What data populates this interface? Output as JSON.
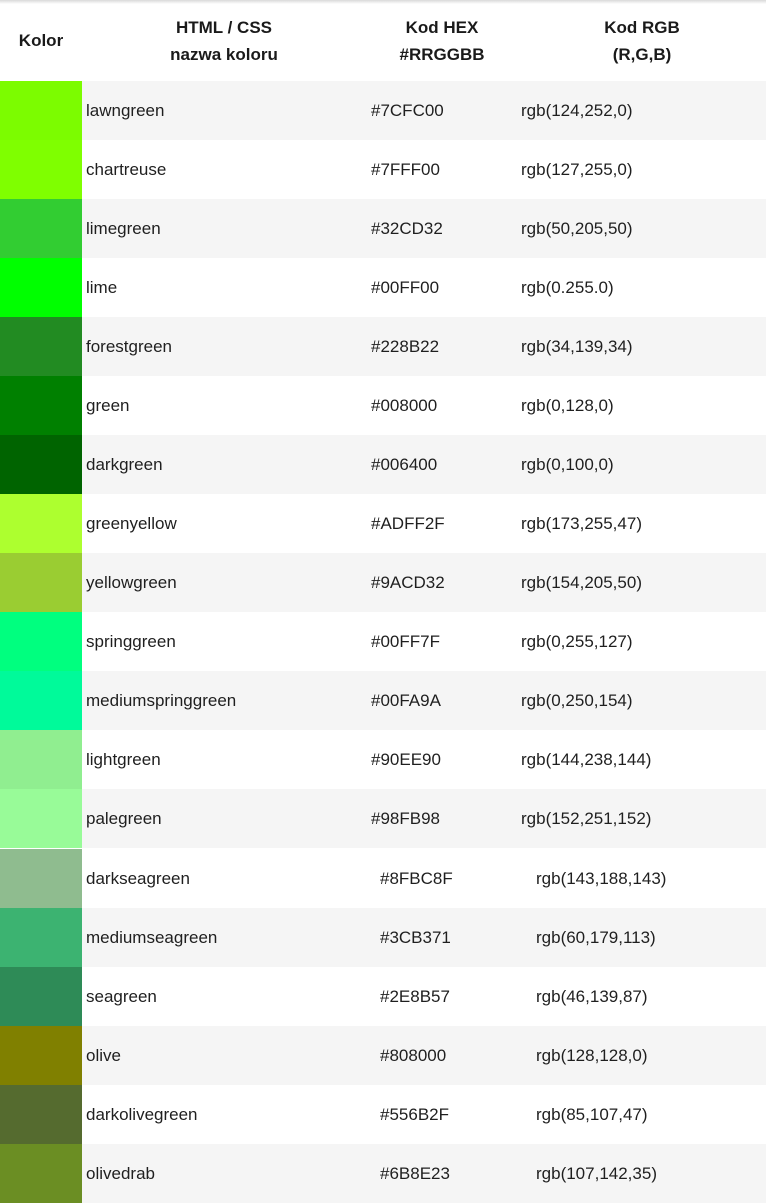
{
  "header": {
    "kolor": "Kolor",
    "name_line1": "HTML / CSS",
    "name_line2": "nazwa koloru",
    "hex_line1": "Kod HEX",
    "hex_line2": "#RRGGBB",
    "rgb_line1": "Kod RGB",
    "rgb_line2": "(R,G,B)"
  },
  "rows": [
    {
      "color": "#7CFC00",
      "name": "lawngreen",
      "hex": "#7CFC00",
      "rgb": "rgb(124,252,0)"
    },
    {
      "color": "#7FFF00",
      "name": "chartreuse",
      "hex": "#7FFF00",
      "rgb": "rgb(127,255,0)"
    },
    {
      "color": "#32CD32",
      "name": "limegreen",
      "hex": "#32CD32",
      "rgb": "rgb(50,205,50)"
    },
    {
      "color": "#00FF00",
      "name": "lime",
      "hex": "#00FF00",
      "rgb": "rgb(0.255.0)"
    },
    {
      "color": "#228B22",
      "name": "forestgreen",
      "hex": "#228B22",
      "rgb": "rgb(34,139,34)"
    },
    {
      "color": "#008000",
      "name": "green",
      "hex": "#008000",
      "rgb": "rgb(0,128,0)"
    },
    {
      "color": "#006400",
      "name": "darkgreen",
      "hex": "#006400",
      "rgb": "rgb(0,100,0)"
    },
    {
      "color": "#ADFF2F",
      "name": "greenyellow",
      "hex": "#ADFF2F",
      "rgb": "rgb(173,255,47)"
    },
    {
      "color": "#9ACD32",
      "name": "yellowgreen",
      "hex": "#9ACD32",
      "rgb": "rgb(154,205,50)"
    },
    {
      "color": "#00FF7F",
      "name": "springgreen",
      "hex": "#00FF7F",
      "rgb": "rgb(0,255,127)"
    },
    {
      "color": "#00FA9A",
      "name": "mediumspringgreen",
      "hex": "#00FA9A",
      "rgb": "rgb(0,250,154)"
    },
    {
      "color": "#90EE90",
      "name": "lightgreen",
      "hex": "#90EE90",
      "rgb": "rgb(144,238,144)"
    },
    {
      "color": "#98FB98",
      "name": "palegreen",
      "hex": "#98FB98",
      "rgb": "rgb(152,251,152)"
    },
    {
      "color": "#8FBC8F",
      "name": "darkseagreen",
      "hex": "#8FBC8F",
      "rgb": "rgb(143,188,143)"
    },
    {
      "color": "#3CB371",
      "name": "mediumseagreen",
      "hex": "#3CB371",
      "rgb": "rgb(60,179,113)"
    },
    {
      "color": "#2E8B57",
      "name": "seagreen",
      "hex": "#2E8B57",
      "rgb": "rgb(46,139,87)"
    },
    {
      "color": "#808000",
      "name": "olive",
      "hex": "#808000",
      "rgb": "rgb(128,128,0)"
    },
    {
      "color": "#556B2F",
      "name": "darkolivegreen",
      "hex": "#556B2F",
      "rgb": "rgb(85,107,47)"
    },
    {
      "color": "#6B8E23",
      "name": "olivedrab",
      "hex": "#6B8E23",
      "rgb": "rgb(107,142,35)"
    }
  ]
}
